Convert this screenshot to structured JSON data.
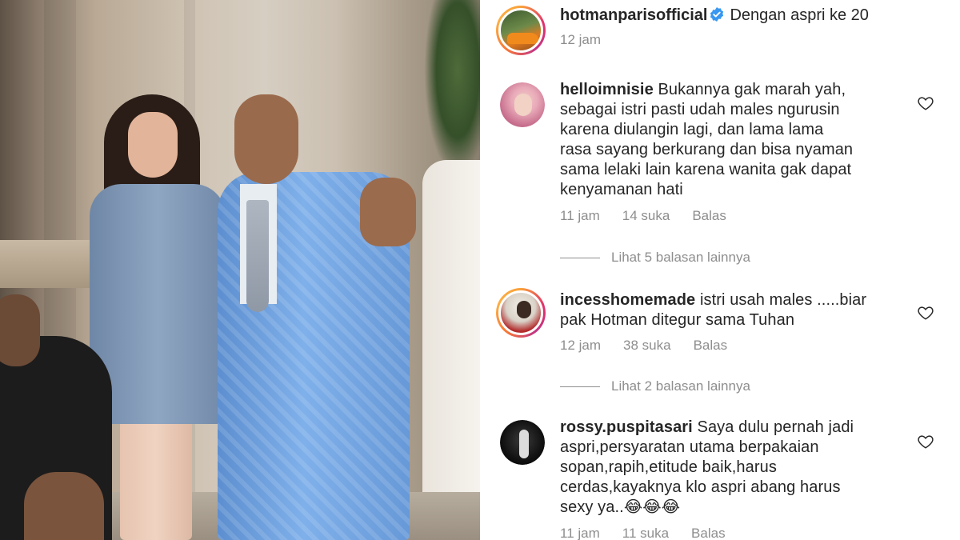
{
  "post": {
    "owner_username": "hotmanparisofficial",
    "caption": "Dengan aspri ke 20",
    "time": "12 jam"
  },
  "comments": [
    {
      "username": "helloimnisie",
      "lines": [
        "Bukannya gak marah yah,",
        "sebagai istri pasti udah males ngurusin",
        "karena diulangin lagi, dan lama lama",
        "rasa sayang berkurang dan bisa nyaman",
        "sama lelaki lain karena wanita gak dapat",
        "kenyamanan hati"
      ],
      "time": "11 jam",
      "likes": "14 suka",
      "reply_label": "Balas",
      "view_replies": "Lihat 5 balasan lainnya"
    },
    {
      "username": "incesshomemade",
      "lines": [
        "istri usah males .....biar",
        "pak Hotman ditegur sama Tuhan"
      ],
      "time": "12 jam",
      "likes": "38 suka",
      "reply_label": "Balas",
      "view_replies": "Lihat 2 balasan lainnya"
    },
    {
      "username": "rossy.puspitasari",
      "lines": [
        "Saya dulu pernah jadi",
        "aspri,persyaratan utama berpakaian",
        "sopan,rapih,etitude baik,harus",
        "cerdas,kayaknya klo aspri abang harus",
        "sexy ya..😂😂😂"
      ],
      "time": "11 jam",
      "likes": "11 suka",
      "reply_label": "Balas"
    }
  ],
  "icons": {
    "verified": "verified-badge-icon",
    "like": "heart-outline-icon"
  },
  "colors": {
    "verified_blue": "#3897f0",
    "muted_text": "#8e8e8e",
    "text": "#262626"
  }
}
